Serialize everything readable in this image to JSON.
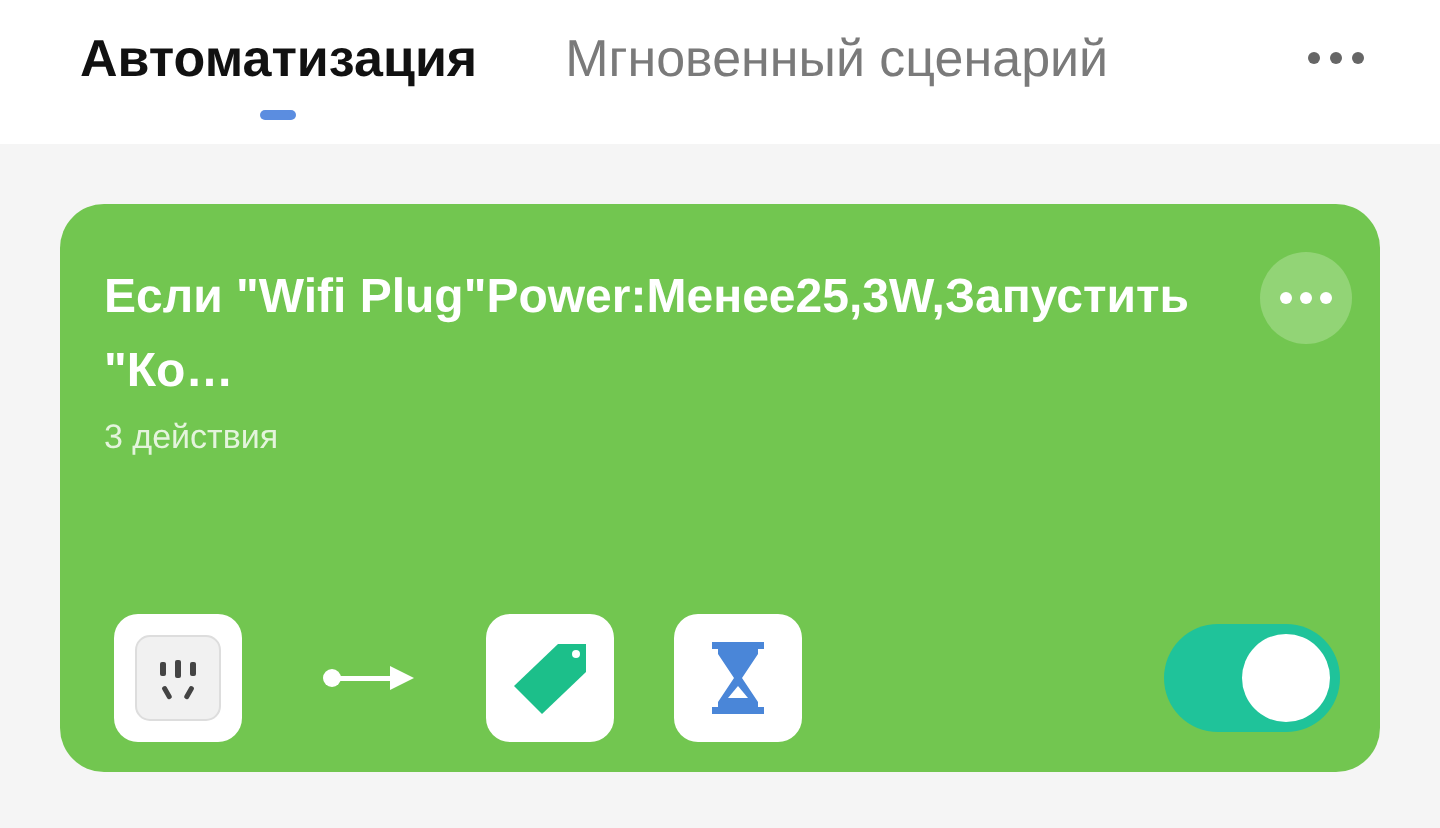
{
  "tabs": [
    {
      "label": "Автоматизация",
      "selected": true
    },
    {
      "label": "Мгновенный сценарий",
      "selected": false
    }
  ],
  "scenes": [
    {
      "title": "Если \"Wifi Plug\"Power:Менее25,3W,Запустить \"Ко…",
      "subtitle": "3 действия",
      "on": true,
      "steps": [
        {
          "kind": "socket"
        },
        {
          "kind": "arrow"
        },
        {
          "kind": "tag"
        },
        {
          "kind": "hourglass"
        }
      ]
    }
  ]
}
